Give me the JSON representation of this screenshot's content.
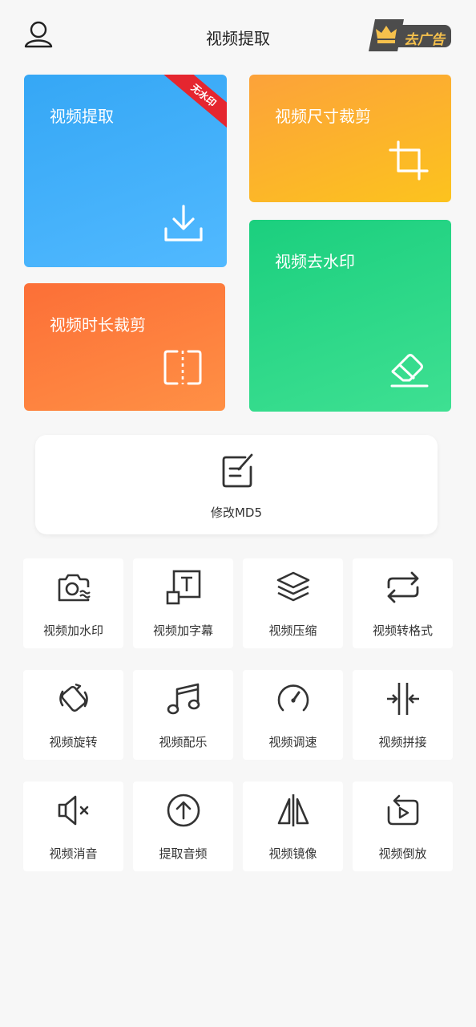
{
  "header": {
    "title": "视频提取",
    "ad_label": "去广告"
  },
  "cards": {
    "extract": {
      "title": "视频提取",
      "badge": "无水印"
    },
    "size_crop": {
      "title": "视频尺寸裁剪"
    },
    "duration_crop": {
      "title": "视频时长裁剪"
    },
    "remove_watermark": {
      "title": "视频去水印"
    }
  },
  "md5": {
    "label": "修改MD5"
  },
  "tools": [
    {
      "label": "视频加水印",
      "icon": "camera-watermark-icon"
    },
    {
      "label": "视频加字幕",
      "icon": "subtitle-icon"
    },
    {
      "label": "视频压缩",
      "icon": "layers-icon"
    },
    {
      "label": "视频转格式",
      "icon": "repeat-icon"
    },
    {
      "label": "视频旋转",
      "icon": "rotate-icon"
    },
    {
      "label": "视频配乐",
      "icon": "music-icon"
    },
    {
      "label": "视频调速",
      "icon": "speedometer-icon"
    },
    {
      "label": "视频拼接",
      "icon": "merge-icon"
    },
    {
      "label": "视频消音",
      "icon": "mute-icon"
    },
    {
      "label": "提取音频",
      "icon": "upload-circle-icon"
    },
    {
      "label": "视频镜像",
      "icon": "mirror-icon"
    },
    {
      "label": "视频倒放",
      "icon": "reverse-play-icon"
    }
  ],
  "colors": {
    "extract_card": "#35a7f5",
    "size_card": "#fca23a",
    "duration_card": "#fc6f37",
    "watermark_card": "#1bcf7e",
    "ribbon": "#e5262f",
    "ad_text": "#f6c14c"
  }
}
